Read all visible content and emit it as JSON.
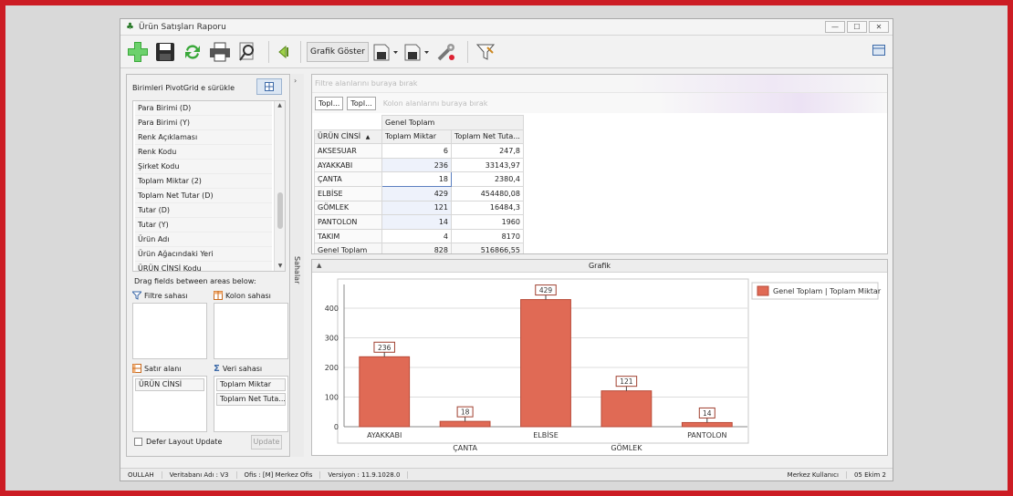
{
  "window": {
    "title": "Ürün Satışları Raporu",
    "controls": [
      "—",
      "☐",
      "✕"
    ]
  },
  "toolbar": {
    "grafik_goster": "Grafik Göster",
    "icons": [
      "add-icon",
      "save-icon",
      "refresh-icon",
      "print-icon",
      "preview-icon",
      "back-icon",
      "export-icon",
      "export2-icon",
      "settings-icon",
      "filter-icon"
    ]
  },
  "field_panel": {
    "header": "Birimleri  PivotGrid e sürükle",
    "fields": [
      "Para Birimi (D)",
      "Para Birimi (Y)",
      "Renk Açıklaması",
      "Renk Kodu",
      "Şirket Kodu",
      "Toplam Miktar (2)",
      "Toplam Net Tutar (D)",
      "Tutar (D)",
      "Tutar (Y)",
      "Ürün Adı",
      "Ürün Ağacındaki Yeri",
      "ÜRÜN CİNSİ Kodu"
    ],
    "drag_label": "Drag fields between areas below:",
    "filter_area": "Filtre sahası",
    "column_area": "Kolon sahası",
    "row_area": "Satır alanı",
    "data_area": "Veri sahası",
    "row_fields": [
      "ÜRÜN CİNSİ"
    ],
    "data_fields": [
      "Toplam Miktar",
      "Toplam Net Tuta..."
    ],
    "defer_label": "Defer Layout Update",
    "update_label": "Update"
  },
  "splitter": {
    "label": "Sahalar",
    "chevron": "›"
  },
  "pivot": {
    "filter_placeholder": "Filtre alanlarını buraya bırak",
    "column_chips": [
      "Topl...",
      "Topl..."
    ],
    "column_placeholder": "Kolon alanlarını buraya bırak",
    "grand_total_header": "Genel Toplam",
    "row_header": "ÜRÜN CİNSİ",
    "sort_glyph": "▲",
    "col_headers": [
      "Toplam Miktar",
      "Toplam Net Tuta..."
    ],
    "rows": [
      {
        "name": "AKSESUAR",
        "qty": "6",
        "net": "247,8"
      },
      {
        "name": "AYAKKABI",
        "qty": "236",
        "net": "33143,97"
      },
      {
        "name": "ÇANTA",
        "qty": "18",
        "net": "2380,4"
      },
      {
        "name": "ELBİSE",
        "qty": "429",
        "net": "454480,08"
      },
      {
        "name": "GÖMLEK",
        "qty": "121",
        "net": "16484,3"
      },
      {
        "name": "PANTOLON",
        "qty": "14",
        "net": "1960"
      },
      {
        "name": "TAKIM",
        "qty": "4",
        "net": "8170"
      }
    ],
    "total": {
      "name": "Genel Toplam",
      "qty": "828",
      "net": "516866,55"
    }
  },
  "chart_panel": {
    "title": "Grafik",
    "collapse_glyph": "▲"
  },
  "chart_data": {
    "type": "bar",
    "categories": [
      "AYAKKABI",
      "ÇANTA",
      "ELBİSE",
      "GÖMLEK",
      "PANTOLON"
    ],
    "series": [
      {
        "name": "Genel Toplam | Toplam Miktar",
        "values": [
          236,
          18,
          429,
          121,
          14
        ],
        "color": "#e06a55"
      }
    ],
    "ylim": [
      0,
      480
    ],
    "yticks": [
      0,
      100,
      200,
      300,
      400
    ],
    "grid": true,
    "legend": "top-right",
    "data_labels": true
  },
  "statusbar": {
    "items": [
      "OULLAH",
      "Veritabanı Adı : V3",
      "Ofis : [M]  Merkez Ofis",
      "Versiyon : 11.9.1028.0"
    ],
    "user": "Merkez Kullanıcı",
    "date": "05 Ekim 2"
  }
}
